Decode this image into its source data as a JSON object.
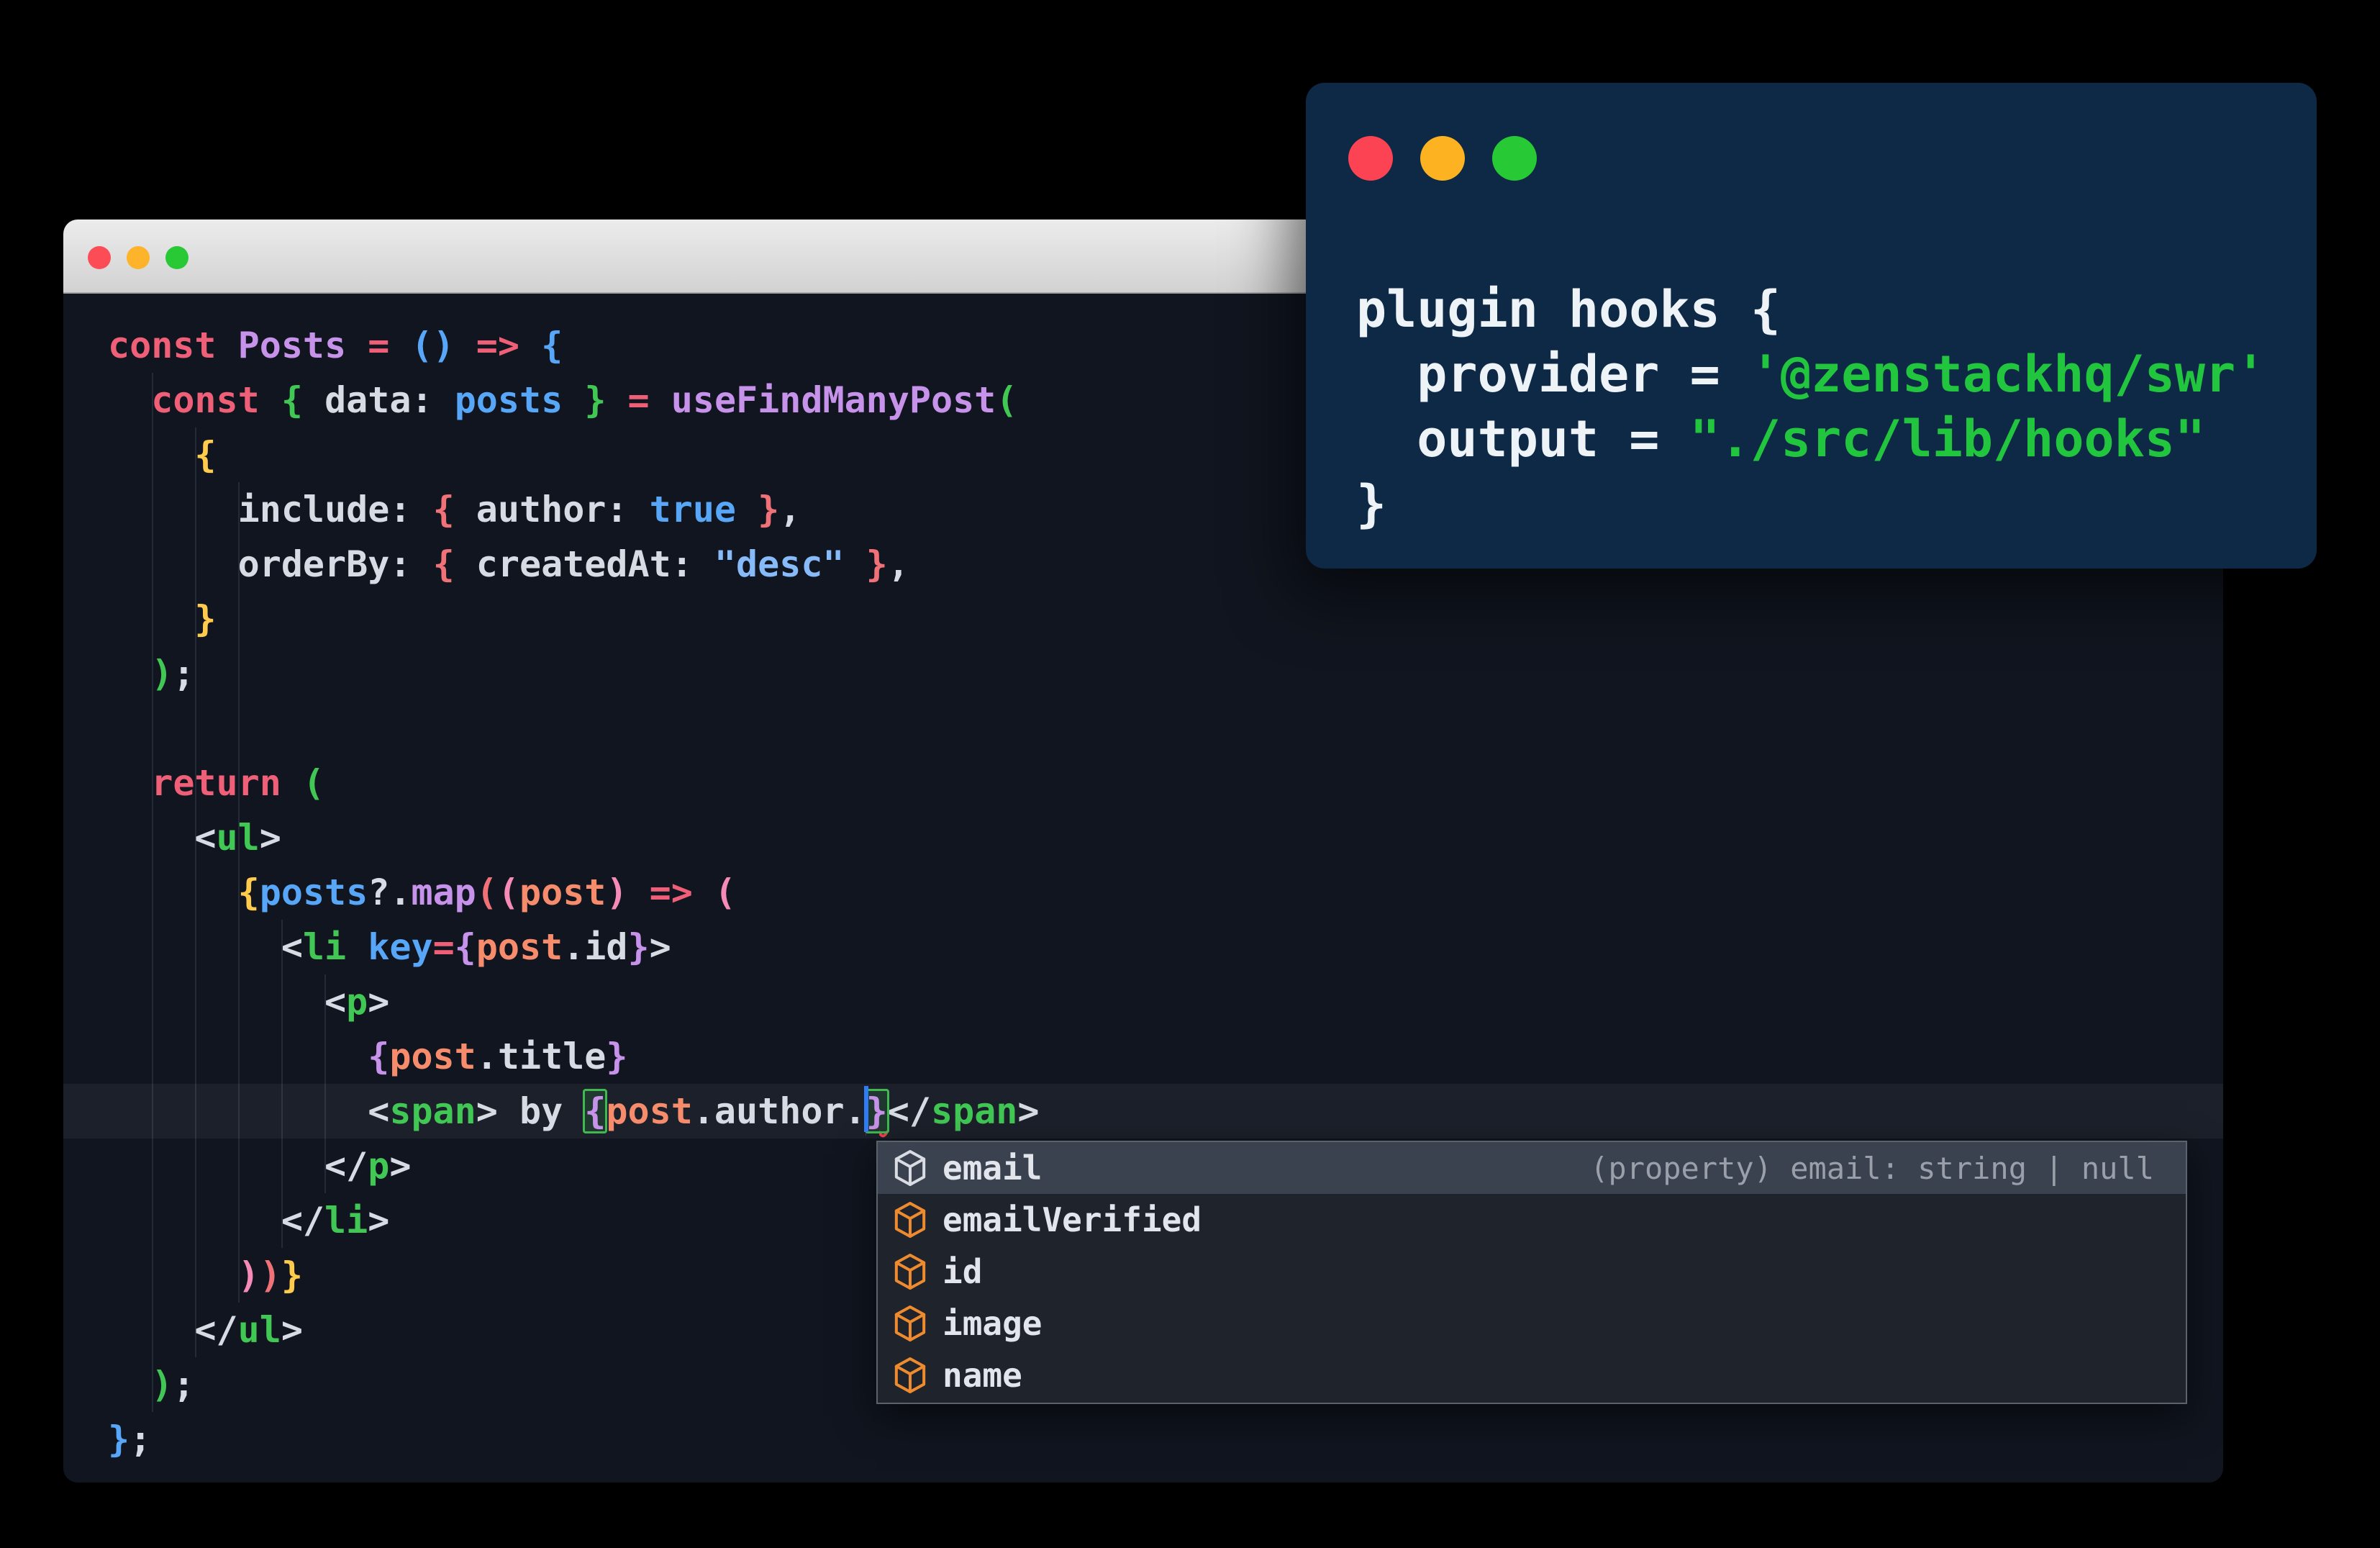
{
  "palette": {
    "editor_bg": "#10151f",
    "titlebar_top": "#ececec",
    "titlebar_bottom": "#d2d2d2",
    "token_red": "#ef6078",
    "token_purple": "#c792ea",
    "token_blue": "#58a6f7",
    "token_string": "#86baf9",
    "token_green": "#41c754",
    "token_gold": "#ffcb4d",
    "token_salmon": "#f07178",
    "token_pink": "#f78bb8",
    "token_orange": "#f78c6c",
    "token_text": "#d6dbe4",
    "light_red": "#fc4d57",
    "light_yellow": "#fdb32a",
    "light_green": "#29c936",
    "popup_bg": "#1f232c",
    "popup_selected_bg": "#3a414f",
    "popup_border": "#5c626b",
    "popup_label": "#e2e6ec",
    "popup_hint": "#9aa0aa",
    "popup_icon_orange": "#ef8b2f",
    "popup_icon_selected": "#d9dde3",
    "overlay_bg": "#0d2946",
    "overlay_text": "#eef3f8",
    "overlay_green": "#22c63e",
    "cursor_blue": "#2f7df6",
    "bracket_match_green": "#3fb950",
    "error_red": "#f23f4f"
  },
  "editor_window": {
    "traffic_lights": [
      "close",
      "minimize",
      "zoom"
    ],
    "code_lines": [
      {
        "segments": [
          {
            "t": "const ",
            "c": "red"
          },
          {
            "t": "Posts ",
            "c": "purple"
          },
          {
            "t": "= ",
            "c": "red"
          },
          {
            "t": "() ",
            "c": "blue"
          },
          {
            "t": "=> ",
            "c": "red"
          },
          {
            "t": "{",
            "c": "blue"
          }
        ]
      },
      {
        "segments": [
          {
            "t": "  ",
            "c": "text"
          },
          {
            "t": "const ",
            "c": "red"
          },
          {
            "t": "{ ",
            "c": "green"
          },
          {
            "t": "data: ",
            "c": "text"
          },
          {
            "t": "posts ",
            "c": "blue"
          },
          {
            "t": "} ",
            "c": "green"
          },
          {
            "t": "= ",
            "c": "red"
          },
          {
            "t": "useFindManyPost",
            "c": "purple"
          },
          {
            "t": "(",
            "c": "green"
          }
        ]
      },
      {
        "segments": [
          {
            "t": "    ",
            "c": "text"
          },
          {
            "t": "{",
            "c": "gold"
          }
        ]
      },
      {
        "segments": [
          {
            "t": "      ",
            "c": "text"
          },
          {
            "t": "include: ",
            "c": "text"
          },
          {
            "t": "{ ",
            "c": "salmon"
          },
          {
            "t": "author: ",
            "c": "text"
          },
          {
            "t": "true ",
            "c": "blue"
          },
          {
            "t": "}",
            "c": "salmon"
          },
          {
            "t": ",",
            "c": "text"
          }
        ]
      },
      {
        "segments": [
          {
            "t": "      ",
            "c": "text"
          },
          {
            "t": "orderBy: ",
            "c": "text"
          },
          {
            "t": "{ ",
            "c": "salmon"
          },
          {
            "t": "createdAt: ",
            "c": "text"
          },
          {
            "t": "\"desc\" ",
            "c": "string"
          },
          {
            "t": "}",
            "c": "salmon"
          },
          {
            "t": ",",
            "c": "text"
          }
        ]
      },
      {
        "segments": [
          {
            "t": "    ",
            "c": "text"
          },
          {
            "t": "}",
            "c": "gold"
          }
        ]
      },
      {
        "segments": [
          {
            "t": "  ",
            "c": "text"
          },
          {
            "t": ")",
            "c": "green"
          },
          {
            "t": ";",
            "c": "text"
          }
        ]
      },
      {
        "segments": []
      },
      {
        "segments": [
          {
            "t": "  ",
            "c": "text"
          },
          {
            "t": "return ",
            "c": "red"
          },
          {
            "t": "(",
            "c": "green"
          }
        ]
      },
      {
        "segments": [
          {
            "t": "    ",
            "c": "text"
          },
          {
            "t": "<",
            "c": "text"
          },
          {
            "t": "ul",
            "c": "green"
          },
          {
            "t": ">",
            "c": "text"
          }
        ]
      },
      {
        "segments": [
          {
            "t": "      ",
            "c": "text"
          },
          {
            "t": "{",
            "c": "gold"
          },
          {
            "t": "posts",
            "c": "blue"
          },
          {
            "t": "?.",
            "c": "text"
          },
          {
            "t": "map",
            "c": "purple"
          },
          {
            "t": "(",
            "c": "salmon"
          },
          {
            "t": "(",
            "c": "pink"
          },
          {
            "t": "post",
            "c": "orange"
          },
          {
            "t": ") ",
            "c": "pink"
          },
          {
            "t": "=> ",
            "c": "red"
          },
          {
            "t": "(",
            "c": "pink"
          }
        ]
      },
      {
        "segments": [
          {
            "t": "        ",
            "c": "text"
          },
          {
            "t": "<",
            "c": "text"
          },
          {
            "t": "li ",
            "c": "green"
          },
          {
            "t": "key",
            "c": "blue"
          },
          {
            "t": "=",
            "c": "red"
          },
          {
            "t": "{",
            "c": "purple"
          },
          {
            "t": "post",
            "c": "orange"
          },
          {
            "t": ".id",
            "c": "text"
          },
          {
            "t": "}",
            "c": "purple"
          },
          {
            "t": ">",
            "c": "text"
          }
        ]
      },
      {
        "segments": [
          {
            "t": "          ",
            "c": "text"
          },
          {
            "t": "<",
            "c": "text"
          },
          {
            "t": "p",
            "c": "green"
          },
          {
            "t": ">",
            "c": "text"
          }
        ]
      },
      {
        "segments": [
          {
            "t": "            ",
            "c": "text"
          },
          {
            "t": "{",
            "c": "purple"
          },
          {
            "t": "post",
            "c": "orange"
          },
          {
            "t": ".title",
            "c": "text"
          },
          {
            "t": "}",
            "c": "purple"
          }
        ]
      },
      {
        "highlight": true,
        "segments": [
          {
            "t": "            ",
            "c": "text"
          },
          {
            "t": "<",
            "c": "text"
          },
          {
            "t": "span",
            "c": "green"
          },
          {
            "t": "> ",
            "c": "text"
          },
          {
            "t": "by ",
            "c": "text"
          },
          {
            "t": "{",
            "c": "purple",
            "match": true
          },
          {
            "t": "post",
            "c": "orange"
          },
          {
            "t": ".author.",
            "c": "text"
          },
          {
            "cursor": true
          },
          {
            "t": "}",
            "c": "purple",
            "match": true,
            "error": true
          },
          {
            "t": "</",
            "c": "text"
          },
          {
            "t": "span",
            "c": "green"
          },
          {
            "t": ">",
            "c": "text"
          }
        ]
      },
      {
        "segments": [
          {
            "t": "          ",
            "c": "text"
          },
          {
            "t": "</",
            "c": "text"
          },
          {
            "t": "p",
            "c": "green"
          },
          {
            "t": ">",
            "c": "text"
          }
        ]
      },
      {
        "segments": [
          {
            "t": "        ",
            "c": "text"
          },
          {
            "t": "</",
            "c": "text"
          },
          {
            "t": "li",
            "c": "green"
          },
          {
            "t": ">",
            "c": "text"
          }
        ]
      },
      {
        "segments": [
          {
            "t": "      ",
            "c": "text"
          },
          {
            "t": ")",
            "c": "pink"
          },
          {
            "t": ")",
            "c": "salmon"
          },
          {
            "t": "}",
            "c": "gold"
          }
        ]
      },
      {
        "segments": [
          {
            "t": "    ",
            "c": "text"
          },
          {
            "t": "</",
            "c": "text"
          },
          {
            "t": "ul",
            "c": "green"
          },
          {
            "t": ">",
            "c": "text"
          }
        ]
      },
      {
        "segments": [
          {
            "t": "  ",
            "c": "text"
          },
          {
            "t": ")",
            "c": "green"
          },
          {
            "t": ";",
            "c": "text"
          }
        ]
      },
      {
        "segments": [
          {
            "t": "}",
            "c": "blue"
          },
          {
            "t": ";",
            "c": "text"
          }
        ]
      }
    ]
  },
  "autocomplete": {
    "items": [
      {
        "label": "email",
        "detail": "(property) email: string | null",
        "selected": true,
        "icon": "symbol-field-icon"
      },
      {
        "label": "emailVerified",
        "icon": "symbol-field-icon"
      },
      {
        "label": "id",
        "icon": "symbol-field-icon"
      },
      {
        "label": "image",
        "icon": "symbol-field-icon"
      },
      {
        "label": "name",
        "icon": "symbol-field-icon"
      }
    ]
  },
  "overlay_window": {
    "traffic_lights": [
      "close",
      "minimize",
      "zoom"
    ],
    "code_lines": [
      {
        "segments": [
          {
            "t": "plugin hooks {",
            "c": "wtext"
          }
        ]
      },
      {
        "segments": [
          {
            "t": "  provider = ",
            "c": "wtext"
          },
          {
            "t": "'@zenstackhq/swr'",
            "c": "wgreen"
          }
        ]
      },
      {
        "segments": [
          {
            "t": "  output = ",
            "c": "wtext"
          },
          {
            "t": "\"./src/lib/hooks\"",
            "c": "wgreen"
          }
        ]
      },
      {
        "segments": [
          {
            "t": "}",
            "c": "wtext"
          }
        ]
      }
    ]
  }
}
